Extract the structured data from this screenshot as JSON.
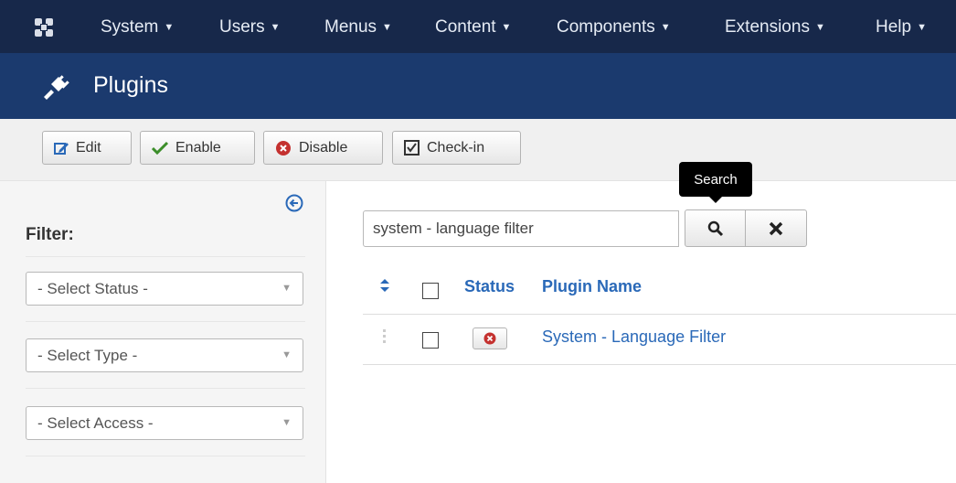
{
  "navbar": {
    "logo_icon": "joomla-logo-icon",
    "items": [
      {
        "label": "System",
        "icon": "caret-down-icon"
      },
      {
        "label": "Users",
        "icon": "caret-down-icon"
      },
      {
        "label": "Menus",
        "icon": "caret-down-icon"
      },
      {
        "label": "Content",
        "icon": "caret-down-icon"
      },
      {
        "label": "Components",
        "icon": "caret-down-icon"
      },
      {
        "label": "Extensions",
        "icon": "caret-down-icon"
      },
      {
        "label": "Help",
        "icon": "caret-down-icon"
      }
    ]
  },
  "header": {
    "title": "Plugins",
    "icon": "plug-icon"
  },
  "toolbar": {
    "edit_label": "Edit",
    "enable_label": "Enable",
    "disable_label": "Disable",
    "checkin_label": "Check-in"
  },
  "sidebar": {
    "filter_label": "Filter:",
    "collapse_icon": "arrow-left-circle-icon",
    "status_select": "- Select Status -",
    "type_select": "- Select Type -",
    "access_select": "- Select Access -"
  },
  "search": {
    "value": "system - language filter",
    "tooltip": "Search",
    "search_icon": "search-icon",
    "clear_icon": "close-icon"
  },
  "table": {
    "columns": {
      "status": "Status",
      "name": "Plugin Name"
    },
    "rows": [
      {
        "name": "System - Language Filter",
        "status": "disabled"
      }
    ]
  },
  "colors": {
    "navbar_bg": "#17284a",
    "header_bg": "#1b3a6e",
    "link": "#2a69b8",
    "enable_green": "#3c8e2a",
    "disable_red": "#c4312f"
  }
}
